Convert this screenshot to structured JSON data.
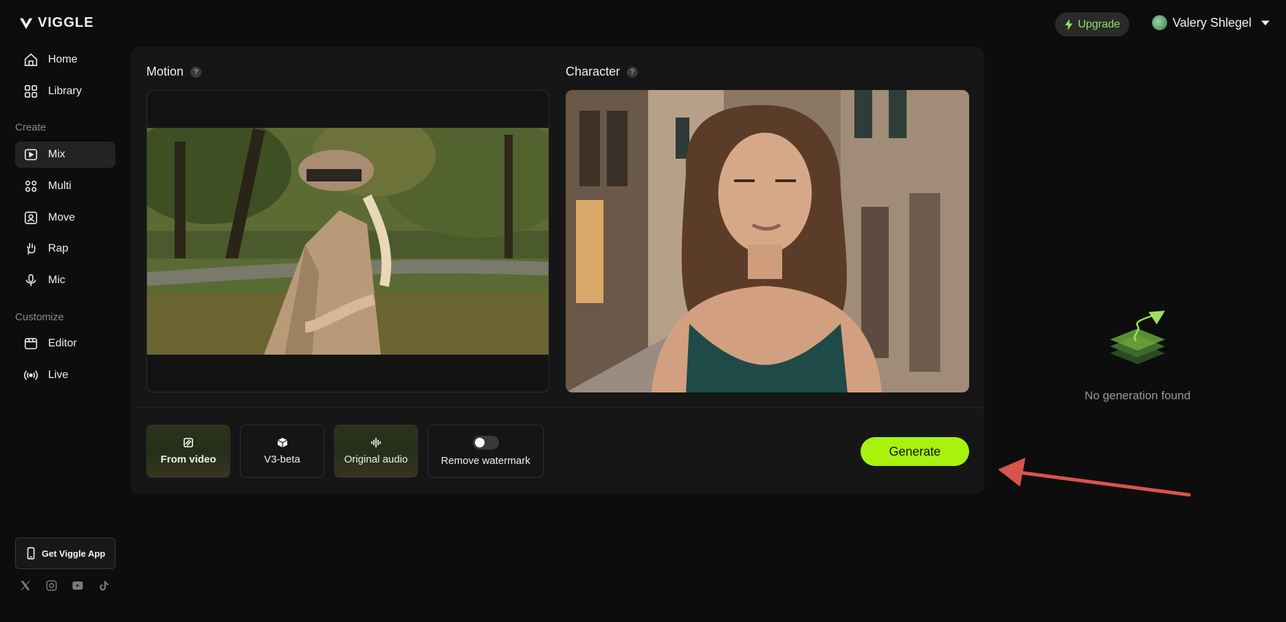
{
  "brand": {
    "name": "VIGGLE"
  },
  "nav": {
    "items": [
      {
        "label": "Home"
      },
      {
        "label": "Library"
      }
    ],
    "create_label": "Create",
    "create_items": [
      {
        "label": "Mix"
      },
      {
        "label": "Multi"
      },
      {
        "label": "Move"
      },
      {
        "label": "Rap"
      },
      {
        "label": "Mic"
      }
    ],
    "customize_label": "Customize",
    "customize_items": [
      {
        "label": "Editor"
      },
      {
        "label": "Live"
      }
    ],
    "app_button": "Get Viggle App",
    "socials": [
      "x-icon",
      "instagram-icon",
      "youtube-icon",
      "tiktok-icon"
    ]
  },
  "header": {
    "upgrade_label": "Upgrade",
    "user_name": "Valery Shlegel"
  },
  "main": {
    "motion_label": "Motion",
    "character_label": "Character",
    "options": [
      {
        "label": "From video"
      },
      {
        "label": "V3-beta"
      },
      {
        "label": "Original audio"
      },
      {
        "label": "Remove watermark"
      }
    ],
    "generate_label": "Generate"
  },
  "results": {
    "empty_text": "No generation found"
  },
  "colors": {
    "accent": "#a8f20e",
    "upgrade_text": "#8fe36a",
    "arrow": "#d9534f",
    "background": "#0d0d0d",
    "panel": "#161616"
  }
}
